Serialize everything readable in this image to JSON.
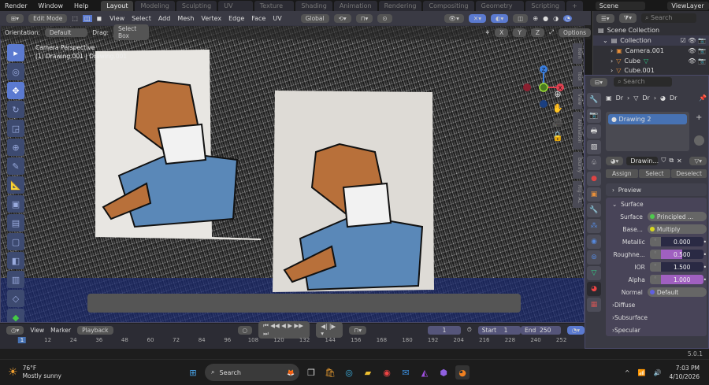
{
  "menu": [
    "Render",
    "Window",
    "Help"
  ],
  "workspaces": [
    {
      "label": "Layout",
      "active": true
    },
    {
      "label": "Modeling"
    },
    {
      "label": "Sculpting"
    },
    {
      "label": "UV Editing"
    },
    {
      "label": "Texture Paint"
    },
    {
      "label": "Shading"
    },
    {
      "label": "Animation"
    },
    {
      "label": "Rendering"
    },
    {
      "label": "Compositing"
    },
    {
      "label": "Geometry Nodes"
    },
    {
      "label": "Scripting"
    }
  ],
  "scene": "Scene",
  "view_layer": "ViewLayer",
  "header": {
    "mode": "Edit Mode",
    "menus": [
      "View",
      "Select",
      "Add",
      "Mesh",
      "Vertex",
      "Edge",
      "Face",
      "UV"
    ],
    "transform": "Global"
  },
  "tool_settings": {
    "orientation_label": "Orientation:",
    "orientation": "Default",
    "drag_label": "Drag:",
    "drag": "Select Box",
    "axes": [
      "X",
      "Y",
      "Z"
    ],
    "options": "Options"
  },
  "viewport": {
    "title": "Camera Perspective",
    "subtitle": "(1) Drawing.001 | Drawing.001",
    "gizmo": [
      "Z",
      "X"
    ],
    "side_tabs": [
      "Item",
      "Tool",
      "View",
      "Animation",
      "Blurify",
      "Rig - AL"
    ]
  },
  "outliner": {
    "search_placeholder": "Search",
    "root": "Scene Collection",
    "items": [
      "Collection",
      "Camera.001",
      "Cube",
      "Cube.001"
    ]
  },
  "properties": {
    "search_placeholder": "Search",
    "breadcrumb": [
      "Dr",
      "Dr",
      "Dr"
    ],
    "slot": "Drawing 2",
    "material": "Drawin...",
    "buttons": [
      "Assign",
      "Select",
      "Deselect"
    ],
    "sections": {
      "preview": "Preview",
      "surface": "Surface"
    },
    "fields": [
      {
        "label": "Surface",
        "type": "pill",
        "value": "Principled ...",
        "color": "#4ec94e"
      },
      {
        "label": "Base...",
        "type": "pill",
        "value": "Multiply",
        "color": "#d8d820"
      },
      {
        "label": "Metallic",
        "type": "slider",
        "value": "0.000",
        "fill": 0
      },
      {
        "label": "Roughne...",
        "type": "slider",
        "value": "0.500",
        "fill": 0.5
      },
      {
        "label": "IOR",
        "type": "slider",
        "value": "1.500",
        "fill": 0
      },
      {
        "label": "Alpha",
        "type": "slider",
        "value": "1.000",
        "fill": 1
      },
      {
        "label": "Normal",
        "type": "pill",
        "value": "Default",
        "color": "#6060e0"
      }
    ],
    "subsections": [
      "Diffuse",
      "Subsurface",
      "Specular"
    ]
  },
  "timeline": {
    "menus": [
      "View",
      "Marker",
      "Playback"
    ],
    "current_frame": "1",
    "start_label": "Start",
    "start": "1",
    "end_label": "End",
    "end": "250",
    "ticks": [
      "1",
      "12",
      "24",
      "36",
      "48",
      "60",
      "72",
      "84",
      "96",
      "108",
      "120",
      "132",
      "144",
      "156",
      "168",
      "180",
      "192",
      "204",
      "216",
      "228",
      "240",
      "252"
    ]
  },
  "status": {
    "version": "5.0.1"
  },
  "taskbar": {
    "weather_temp": "76°F",
    "weather_desc": "Mostly sunny",
    "search": "Search",
    "time": "7:03 PM",
    "date": "4/10/2026"
  },
  "colors": {
    "accent": "#5b7ad0",
    "alpha_fill": "#a060c0",
    "fox_orange": "#b8703a",
    "fox_blue": "#5a88b8"
  }
}
